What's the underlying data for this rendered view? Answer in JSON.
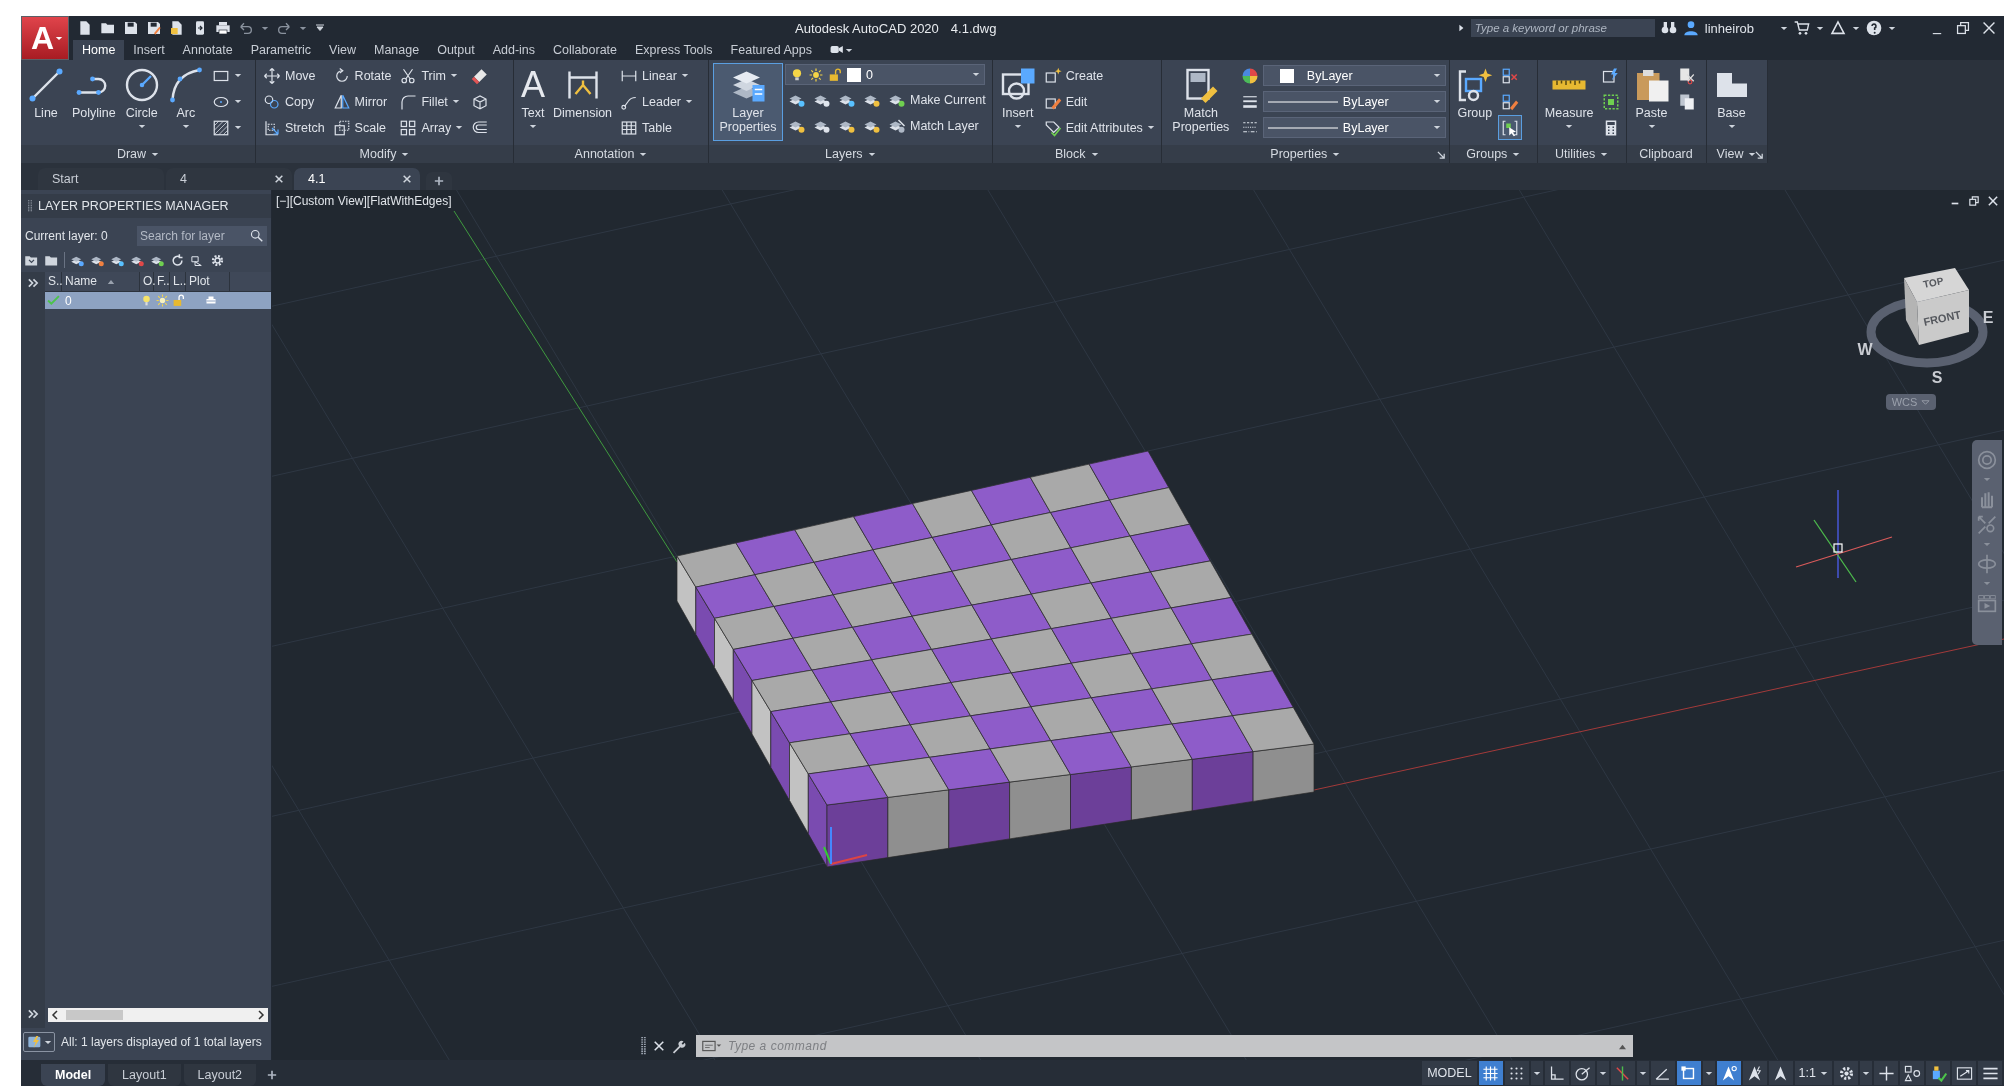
{
  "app_button": {
    "glyph": "A"
  },
  "title_bar": {
    "title": "Autodesk AutoCAD 2020",
    "file": "4.1.dwg",
    "search": {
      "placeholder": "Type a keyword or phrase"
    },
    "user": "linheirob"
  },
  "ribbon_tabs": [
    {
      "label": "Home",
      "selected": true
    },
    {
      "label": "Insert",
      "selected": false
    },
    {
      "label": "Annotate",
      "selected": false
    },
    {
      "label": "Parametric",
      "selected": false
    },
    {
      "label": "View",
      "selected": false
    },
    {
      "label": "Manage",
      "selected": false
    },
    {
      "label": "Output",
      "selected": false
    },
    {
      "label": "Add-ins",
      "selected": false
    },
    {
      "label": "Collaborate",
      "selected": false
    },
    {
      "label": "Express Tools",
      "selected": false
    },
    {
      "label": "Featured Apps",
      "selected": false
    }
  ],
  "ribbon_panels": [
    {
      "title": "Draw",
      "dropdown": true,
      "launcher": false,
      "columns": [
        {
          "items": [
            {
              "kind": "large",
              "label": "Line",
              "dropdown": false,
              "pressed": false
            }
          ]
        },
        {
          "items": [
            {
              "kind": "large",
              "label": "Polyline",
              "dropdown": false,
              "pressed": false
            }
          ]
        },
        {
          "items": [
            {
              "kind": "large",
              "label": "Circle",
              "dropdown": true,
              "pressed": false
            }
          ]
        },
        {
          "items": [
            {
              "kind": "large",
              "label": "Arc",
              "dropdown": true,
              "pressed": false
            }
          ]
        },
        {
          "items": [
            {
              "kind": "small",
              "dropdown": true,
              "pressed": false
            },
            {
              "kind": "small",
              "dropdown": true,
              "pressed": false
            },
            {
              "kind": "small",
              "dropdown": true,
              "pressed": false
            }
          ]
        }
      ]
    },
    {
      "title": "Modify",
      "dropdown": true,
      "launcher": false,
      "columns": [
        {
          "items": [
            {
              "kind": "small",
              "label": "Move",
              "dropdown": false,
              "pressed": false
            },
            {
              "kind": "small",
              "label": "Copy",
              "dropdown": false,
              "pressed": false
            },
            {
              "kind": "small",
              "label": "Stretch",
              "dropdown": false,
              "pressed": false
            }
          ]
        },
        {
          "items": [
            {
              "kind": "small",
              "label": "Rotate",
              "dropdown": false,
              "pressed": false
            },
            {
              "kind": "small",
              "label": "Mirror",
              "dropdown": false,
              "pressed": false
            },
            {
              "kind": "small",
              "label": "Scale",
              "dropdown": false,
              "pressed": false
            }
          ]
        },
        {
          "items": [
            {
              "kind": "small",
              "label": "Trim",
              "dropdown": true,
              "pressed": false
            },
            {
              "kind": "small",
              "label": "Fillet",
              "dropdown": true,
              "pressed": false
            },
            {
              "kind": "small",
              "label": "Array",
              "dropdown": true,
              "pressed": false
            }
          ]
        },
        {
          "items": [
            {
              "kind": "small",
              "dropdown": false,
              "pressed": false
            },
            {
              "kind": "small",
              "dropdown": false,
              "pressed": false
            },
            {
              "kind": "small",
              "dropdown": false,
              "pressed": false
            }
          ]
        }
      ]
    },
    {
      "title": "Annotation",
      "dropdown": true,
      "launcher": false,
      "columns": [
        {
          "items": [
            {
              "kind": "large",
              "label": "Text",
              "glyph": "A",
              "dropdown": true,
              "pressed": false
            }
          ]
        },
        {
          "items": [
            {
              "kind": "large",
              "label": "Dimension",
              "dropdown": false,
              "pressed": false
            }
          ]
        },
        {
          "items": [
            {
              "kind": "small",
              "label": "Linear",
              "dropdown": true,
              "pressed": false
            },
            {
              "kind": "small",
              "label": "Leader",
              "dropdown": true,
              "pressed": false
            },
            {
              "kind": "small",
              "label": "Table",
              "dropdown": false,
              "pressed": false
            }
          ]
        }
      ]
    },
    {
      "title": "Layers",
      "dropdown": true,
      "launcher": false,
      "columns": [
        {
          "items": [
            {
              "kind": "large",
              "label": "Layer Properties",
              "dropdown": false,
              "pressed": true
            }
          ]
        },
        {
          "items": [
            {
              "kind": "layer-combo",
              "value": "0"
            },
            {
              "kind": "row",
              "items": [
                {
                  "kind": "small",
                  "dropdown": false,
                  "pressed": false
                },
                {
                  "kind": "small",
                  "dropdown": false,
                  "pressed": false
                },
                {
                  "kind": "small",
                  "dropdown": false,
                  "pressed": false
                },
                {
                  "kind": "small",
                  "dropdown": false,
                  "pressed": false
                },
                {
                  "kind": "small",
                  "label": "Make Current",
                  "dropdown": false,
                  "pressed": false
                }
              ]
            },
            {
              "kind": "row",
              "items": [
                {
                  "kind": "small",
                  "dropdown": false,
                  "pressed": false
                },
                {
                  "kind": "small",
                  "dropdown": false,
                  "pressed": false
                },
                {
                  "kind": "small",
                  "dropdown": false,
                  "pressed": false
                },
                {
                  "kind": "small",
                  "dropdown": false,
                  "pressed": false
                },
                {
                  "kind": "small",
                  "label": "Match Layer",
                  "dropdown": false,
                  "pressed": false
                }
              ]
            }
          ]
        }
      ]
    },
    {
      "title": "Block",
      "dropdown": true,
      "launcher": false,
      "columns": [
        {
          "items": [
            {
              "kind": "large",
              "label": "Insert",
              "dropdown": true,
              "pressed": false
            }
          ]
        },
        {
          "items": [
            {
              "kind": "small",
              "label": "Create",
              "dropdown": false,
              "pressed": false
            },
            {
              "kind": "small",
              "label": "Edit",
              "dropdown": false,
              "pressed": false
            },
            {
              "kind": "small",
              "label": "Edit Attributes",
              "dropdown": true,
              "pressed": false
            }
          ]
        }
      ]
    },
    {
      "title": "Properties",
      "dropdown": true,
      "launcher": true,
      "columns": [
        {
          "items": [
            {
              "kind": "large",
              "label": "Match Properties",
              "dropdown": false,
              "pressed": false
            }
          ]
        },
        {
          "items": [
            {
              "kind": "row",
              "items": [
                {
                  "kind": "small",
                  "dropdown": false,
                  "pressed": false
                },
                {
                  "kind": "swatch-combo",
                  "value": "ByLayer"
                }
              ]
            },
            {
              "kind": "row",
              "items": [
                {
                  "kind": "small",
                  "dropdown": false,
                  "pressed": false
                },
                {
                  "kind": "linetype-combo",
                  "value": "ByLayer"
                }
              ]
            },
            {
              "kind": "row",
              "items": [
                {
                  "kind": "small",
                  "dropdown": false,
                  "pressed": false
                },
                {
                  "kind": "linetype-combo",
                  "value": "ByLayer"
                }
              ]
            }
          ]
        }
      ]
    },
    {
      "title": "Groups",
      "dropdown": true,
      "launcher": false,
      "columns": [
        {
          "items": [
            {
              "kind": "large",
              "label": "Group",
              "dropdown": false,
              "pressed": false
            }
          ]
        },
        {
          "items": [
            {
              "kind": "small",
              "dropdown": false,
              "pressed": false
            },
            {
              "kind": "small",
              "dropdown": false,
              "pressed": false
            },
            {
              "kind": "small",
              "dropdown": false,
              "pressed": true
            }
          ]
        }
      ]
    },
    {
      "title": "Utilities",
      "dropdown": true,
      "launcher": false,
      "columns": [
        {
          "items": [
            {
              "kind": "large",
              "label": "Measure",
              "dropdown": true,
              "pressed": false
            }
          ]
        },
        {
          "items": [
            {
              "kind": "small",
              "dropdown": false,
              "pressed": false
            },
            {
              "kind": "small",
              "dropdown": false,
              "pressed": false
            },
            {
              "kind": "small",
              "dropdown": false,
              "pressed": false
            }
          ]
        }
      ]
    },
    {
      "title": "Clipboard",
      "dropdown": false,
      "launcher": false,
      "columns": [
        {
          "items": [
            {
              "kind": "large",
              "label": "Paste",
              "dropdown": true,
              "pressed": false
            }
          ]
        },
        {
          "items": [
            {
              "kind": "small",
              "dropdown": false,
              "pressed": false
            },
            {
              "kind": "small",
              "dropdown": false,
              "pressed": false
            }
          ]
        }
      ]
    },
    {
      "title": "View",
      "dropdown": true,
      "launcher": true,
      "columns": [
        {
          "items": [
            {
              "kind": "large",
              "label": "Base",
              "dropdown": true,
              "pressed": false
            }
          ]
        }
      ]
    }
  ],
  "document_tabs": [
    {
      "label": "Start",
      "selected": false,
      "closable": false
    },
    {
      "label": "4",
      "selected": false,
      "closable": true
    },
    {
      "label": "4.1",
      "selected": true,
      "closable": true
    }
  ],
  "layer_palette": {
    "title": "LAYER PROPERTIES MANAGER",
    "current_layer": "Current layer: 0",
    "search": {
      "placeholder": "Search for layer"
    },
    "columns": [
      "S..",
      "Name",
      "O.",
      "F..",
      "L..",
      "Plot"
    ],
    "rows": [
      {
        "name": "0",
        "selected": true,
        "current": true
      }
    ],
    "footer": "All: 1 layers displayed of 1 total layers"
  },
  "viewport": {
    "label": "[−][Custom View][FlatWithEdges]",
    "viewcube": {
      "faces": [
        "TOP",
        "FRONT"
      ],
      "directions": [
        "W",
        "E",
        "S"
      ],
      "coordinate_system": "WCS"
    }
  },
  "command_line": {
    "placeholder": "Type a command"
  },
  "layout_tabs": [
    {
      "label": "Model",
      "selected": true
    },
    {
      "label": "Layout1",
      "selected": false
    },
    {
      "label": "Layout2",
      "selected": false
    }
  ],
  "status_bar": {
    "space": "MODEL",
    "tools": [
      {
        "kind": "toggle",
        "on": true
      },
      {
        "kind": "toggle",
        "on": false
      },
      {
        "kind": "caret",
        "on": false
      },
      {
        "kind": "toggle",
        "on": false
      },
      {
        "kind": "toggle",
        "on": false
      },
      {
        "kind": "caret",
        "on": false
      },
      {
        "kind": "toggle",
        "on": false
      },
      {
        "kind": "caret",
        "on": false
      },
      {
        "kind": "toggle",
        "on": false
      },
      {
        "kind": "toggle",
        "on": true
      },
      {
        "kind": "caret",
        "on": false
      },
      {
        "kind": "toggle",
        "on": true
      },
      {
        "kind": "toggle",
        "on": false
      },
      {
        "kind": "toggle",
        "on": false
      },
      {
        "kind": "scale",
        "label": "1:1",
        "on": false
      },
      {
        "kind": "toggle",
        "on": false
      },
      {
        "kind": "caret",
        "on": false
      },
      {
        "kind": "toggle",
        "on": false
      },
      {
        "kind": "toggle",
        "on": false
      },
      {
        "kind": "toggle",
        "on": false
      },
      {
        "kind": "toggle",
        "on": false
      },
      {
        "kind": "toggle",
        "on": false
      }
    ]
  }
}
